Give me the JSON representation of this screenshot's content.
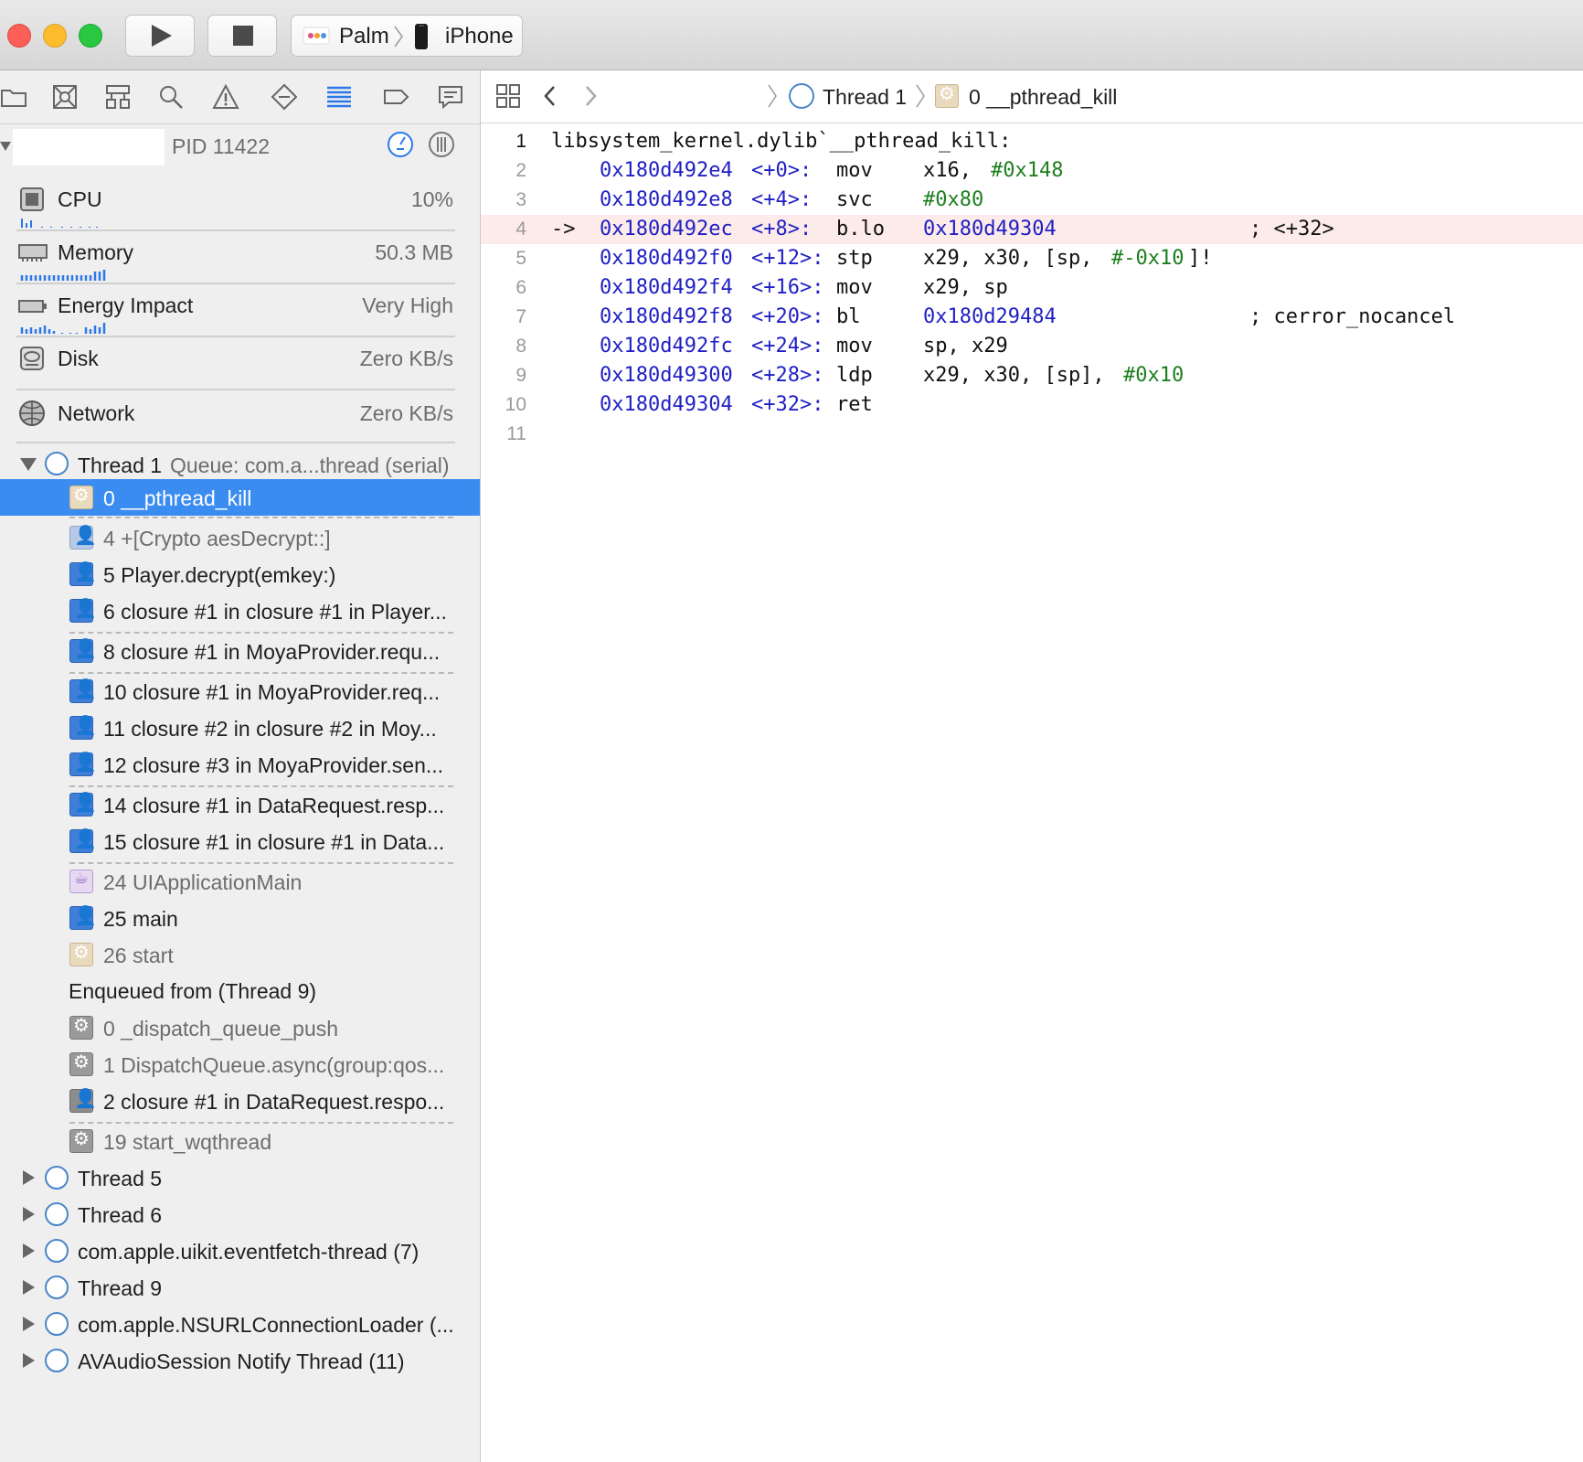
{
  "window": {
    "scheme_target": "Palm",
    "device": "iPhone"
  },
  "debug_gauges": {
    "process_pid": "PID 11422",
    "items": [
      {
        "label": "CPU",
        "value": "10%"
      },
      {
        "label": "Memory",
        "value": "50.3 MB"
      },
      {
        "label": "Energy Impact",
        "value": "Very High"
      },
      {
        "label": "Disk",
        "value": "Zero KB/s"
      },
      {
        "label": "Network",
        "value": "Zero KB/s"
      }
    ]
  },
  "threads": {
    "thread1": {
      "label": "Thread 1",
      "queue": "Queue: com.a...thread (serial)"
    },
    "frames": [
      "0 __pthread_kill",
      "4 +[Crypto aesDecrypt::]",
      "5 Player.decrypt(emkey:)",
      "6 closure #1 in closure #1 in Player...",
      "8 closure #1 in MoyaProvider.requ...",
      "10 closure #1 in MoyaProvider.req...",
      "11 closure #2 in closure #2 in Moy...",
      "12 closure #3 in MoyaProvider.sen...",
      "14 closure #1 in DataRequest.resp...",
      "15 closure #1 in closure #1 in Data...",
      "24 UIApplicationMain",
      "25 main",
      "26 start"
    ],
    "enqueued_label": "Enqueued from  (Thread 9)",
    "enqueued_frames": [
      "0 _dispatch_queue_push",
      "1 DispatchQueue.async(group:qos...",
      "2 closure #1 in DataRequest.respo...",
      "19 start_wqthread"
    ],
    "other_threads": [
      "Thread 5",
      "Thread 6",
      "com.apple.uikit.eventfetch-thread (7)",
      "Thread 9",
      "com.apple.NSURLConnectionLoader (...",
      "AVAudioSession Notify Thread (11)"
    ]
  },
  "jumpbar": {
    "thread": "Thread 1",
    "frame": "0 __pthread_kill"
  },
  "code": {
    "line_numbers": [
      "1",
      "2",
      "3",
      "4",
      "5",
      "6",
      "7",
      "8",
      "9",
      "10",
      "11"
    ],
    "header": "libsystem_kernel.dylib`__pthread_kill:",
    "arrow": "->",
    "rows": [
      {
        "addr": "0x180d492e4",
        "off": "<+0>:",
        "op": "mov",
        "args": "x16, ",
        "imm": "#0x148",
        "tail": "",
        "comment": ""
      },
      {
        "addr": "0x180d492e8",
        "off": "<+4>:",
        "op": "svc",
        "args": "",
        "imm": "#0x80",
        "tail": "",
        "comment": ""
      },
      {
        "addr": "0x180d492ec",
        "off": "<+8>:",
        "op": "b.lo",
        "args": "",
        "target": "0x180d49304",
        "comment": "; <+32>"
      },
      {
        "addr": "0x180d492f0",
        "off": "<+12>:",
        "op": "stp",
        "args": "x29, x30, [sp, ",
        "imm": "#-0x10",
        "tail": "]!",
        "comment": ""
      },
      {
        "addr": "0x180d492f4",
        "off": "<+16>:",
        "op": "mov",
        "args": "x29, sp",
        "comment": ""
      },
      {
        "addr": "0x180d492f8",
        "off": "<+20>:",
        "op": "bl",
        "args": "",
        "target": "0x180d29484",
        "comment": "; cerror_nocancel"
      },
      {
        "addr": "0x180d492fc",
        "off": "<+24>:",
        "op": "mov",
        "args": "sp, x29",
        "comment": ""
      },
      {
        "addr": "0x180d49300",
        "off": "<+28>:",
        "op": "ldp",
        "args": "x29, x30, [sp], ",
        "imm": "#0x10",
        "comment": ""
      },
      {
        "addr": "0x180d49304",
        "off": "<+32>:",
        "op": "ret",
        "args": "",
        "comment": ""
      }
    ]
  },
  "colors": {
    "selection": "#3b8cf0",
    "current_line": "#fcebe8",
    "address": "#1f1fc4",
    "immediate": "#1d7f1d"
  }
}
